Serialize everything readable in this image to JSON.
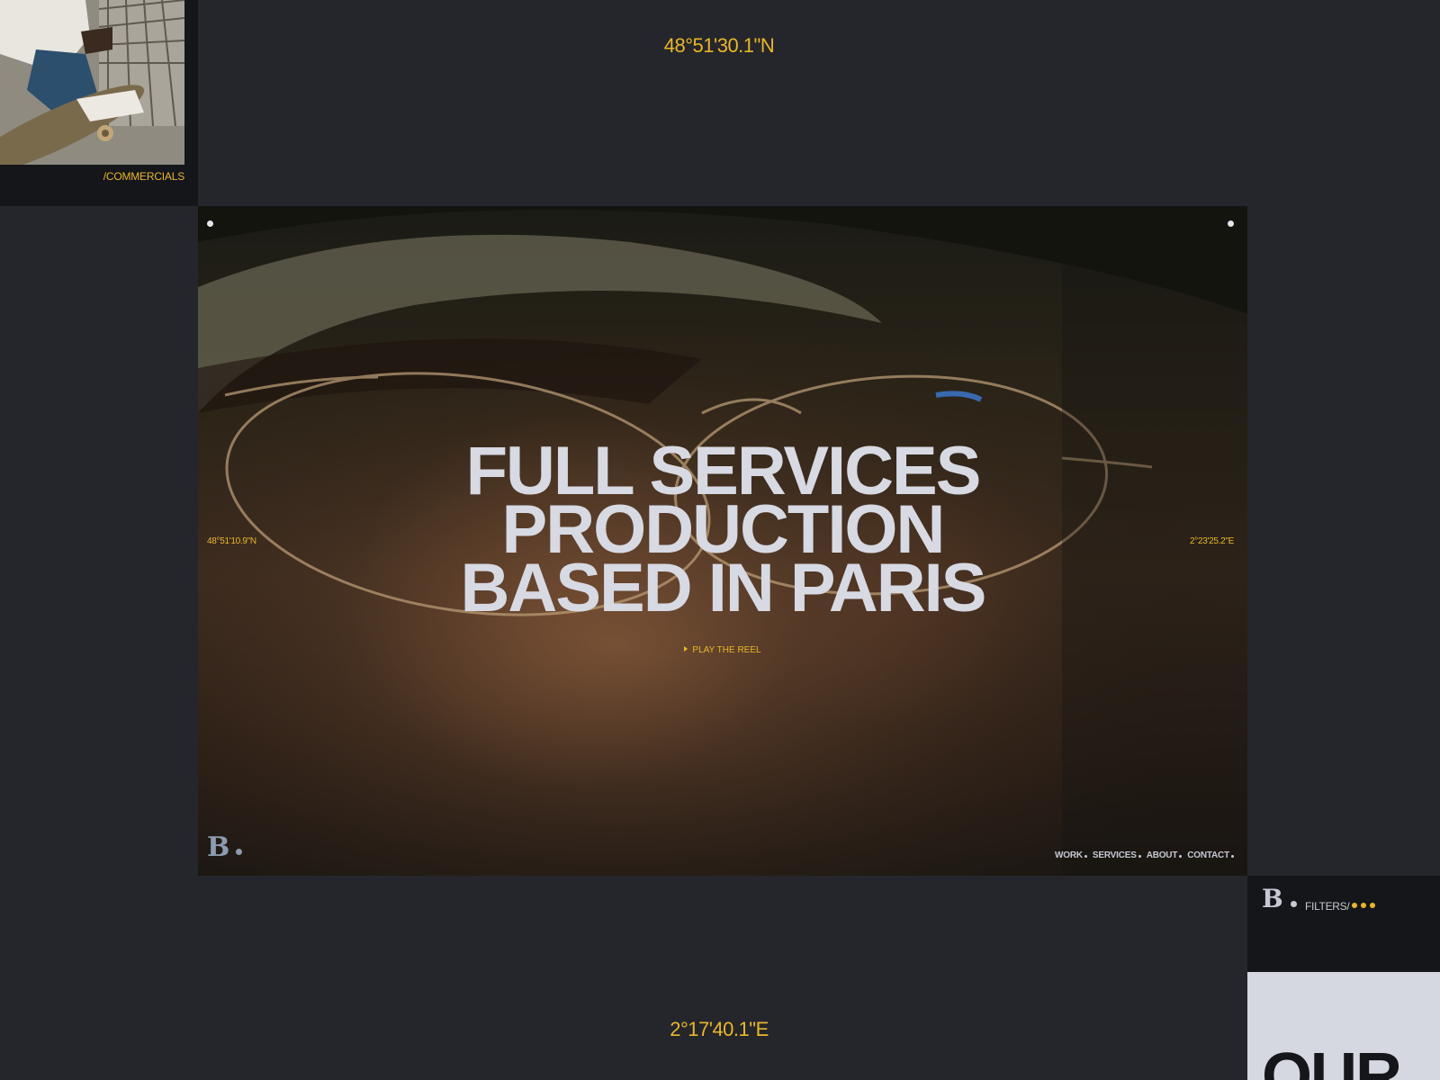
{
  "coordinates": {
    "top": "48°51'30.1\"N",
    "bottom": "2°17'40.1\"E"
  },
  "card_top_left": {
    "label": "/COMMERCIALS"
  },
  "hero": {
    "coord_left": "48°51'10.9\"N",
    "coord_right": "2°23'25.2\"E",
    "headline": [
      "FULL SERVICES",
      "PRODUCTION",
      "BASED IN PARIS"
    ],
    "reel_label": "PLAY THE REEL"
  },
  "brand": {
    "logo_letter": "B"
  },
  "nav": {
    "items": [
      "WORK",
      "SERVICES",
      "ABOUT",
      "CONTACT"
    ]
  },
  "panel": {
    "logo_letter": "B",
    "filters_label": "FILTERS/"
  },
  "card_bottom_right": {
    "text": "OUR"
  },
  "colors": {
    "background": "#25262c",
    "accent": "#e9b726",
    "text_light": "#d7d9e3",
    "panel_dark": "#15161a"
  }
}
